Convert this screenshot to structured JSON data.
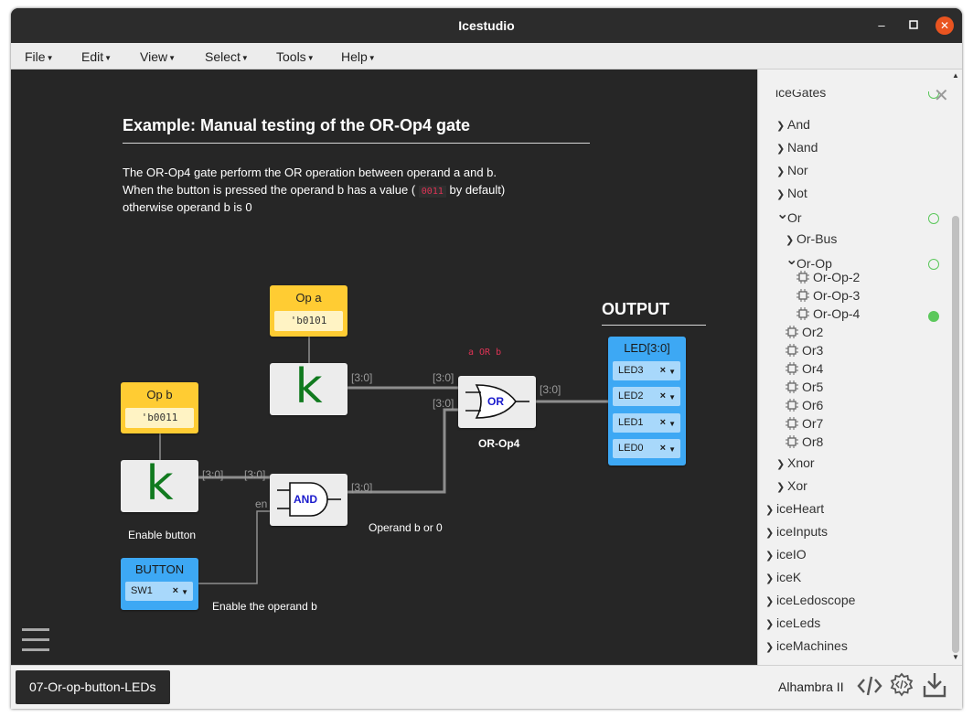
{
  "window": {
    "title": "Icestudio"
  },
  "menu": [
    {
      "label": "File",
      "name": "menu-file"
    },
    {
      "label": "Edit",
      "name": "menu-edit"
    },
    {
      "label": "View",
      "name": "menu-view"
    },
    {
      "label": "Select",
      "name": "menu-select"
    },
    {
      "label": "Tools",
      "name": "menu-tools"
    },
    {
      "label": "Help",
      "name": "menu-help"
    }
  ],
  "canvas": {
    "heading": "Example: Manual testing of the OR-Op4 gate",
    "desc_line1": "The OR-Op4 gate perform the OR operation between operand a and b.",
    "desc_line2_pre": "When the button is pressed the operand b has a value (",
    "desc_line2_code": "0011",
    "desc_line2_post": "by default)",
    "desc_line3": "otherwise operand b is 0",
    "op_a": {
      "label": "Op a",
      "value": "'b0101"
    },
    "op_b": {
      "label": "Op b",
      "value": "'b0011"
    },
    "k_glyph": "k",
    "and_label": "AND",
    "or_label": "OR",
    "or_block_name": "OR-Op4",
    "or_annotation": "a OR b",
    "output_heading": "OUTPUT",
    "leds": {
      "title": "LED[3:0]",
      "pins": [
        "LED3",
        "LED2",
        "LED1",
        "LED0"
      ]
    },
    "button": {
      "title": "BUTTON",
      "pin": "SW1"
    },
    "wire_labels": {
      "bus": "[3:0]",
      "en": "en"
    },
    "captions": {
      "enable_button": "Enable button",
      "operand_b_or_0": "Operand b or 0",
      "enable_operand_b": "Enable the operand b"
    }
  },
  "panel": {
    "partial_top": "iceGates",
    "items": [
      {
        "label": "And",
        "chev": "›",
        "level": 1
      },
      {
        "label": "Nand",
        "chev": "›",
        "level": 1
      },
      {
        "label": "Nor",
        "chev": "›",
        "level": 1
      },
      {
        "label": "Not",
        "chev": "›",
        "level": 1
      },
      {
        "label": "Or",
        "chev": "⌄",
        "level": 1
      },
      {
        "label": "Or-Bus",
        "chev": "›",
        "level": 2
      },
      {
        "label": "Or-Op",
        "chev": "⌄",
        "level": 2
      },
      {
        "label": "Or-Op-2",
        "chip": true,
        "level": 3
      },
      {
        "label": "Or-Op-3",
        "chip": true,
        "level": 3
      },
      {
        "label": "Or-Op-4",
        "chip": true,
        "level": 3
      },
      {
        "label": "Or2",
        "chip": true,
        "level": 2
      },
      {
        "label": "Or3",
        "chip": true,
        "level": 2
      },
      {
        "label": "Or4",
        "chip": true,
        "level": 2
      },
      {
        "label": "Or5",
        "chip": true,
        "level": 2
      },
      {
        "label": "Or6",
        "chip": true,
        "level": 2
      },
      {
        "label": "Or7",
        "chip": true,
        "level": 2
      },
      {
        "label": "Or8",
        "chip": true,
        "level": 2
      },
      {
        "label": "Xnor",
        "chev": "›",
        "level": 1
      },
      {
        "label": "Xor",
        "chev": "›",
        "level": 1
      },
      {
        "label": "iceHeart",
        "chev": "›",
        "level": 0
      },
      {
        "label": "iceInputs",
        "chev": "›",
        "level": 0
      },
      {
        "label": "iceIO",
        "chev": "›",
        "level": 0
      },
      {
        "label": "iceK",
        "chev": "›",
        "level": 0
      },
      {
        "label": "iceLedoscope",
        "chev": "›",
        "level": 0
      },
      {
        "label": "iceLeds",
        "chev": "›",
        "level": 0
      },
      {
        "label": "iceMachines",
        "chev": "›",
        "level": 0
      }
    ]
  },
  "footer": {
    "project_tab": "07-Or-op-button-LEDs",
    "board": "Alhambra II"
  },
  "colors": {
    "canvas_bg": "#262626",
    "const_yellow": "#ffcc33",
    "io_blue": "#3da8f4",
    "k_green": "#117a1f",
    "close_orange": "#e95420",
    "status_green": "#5cc85c"
  }
}
